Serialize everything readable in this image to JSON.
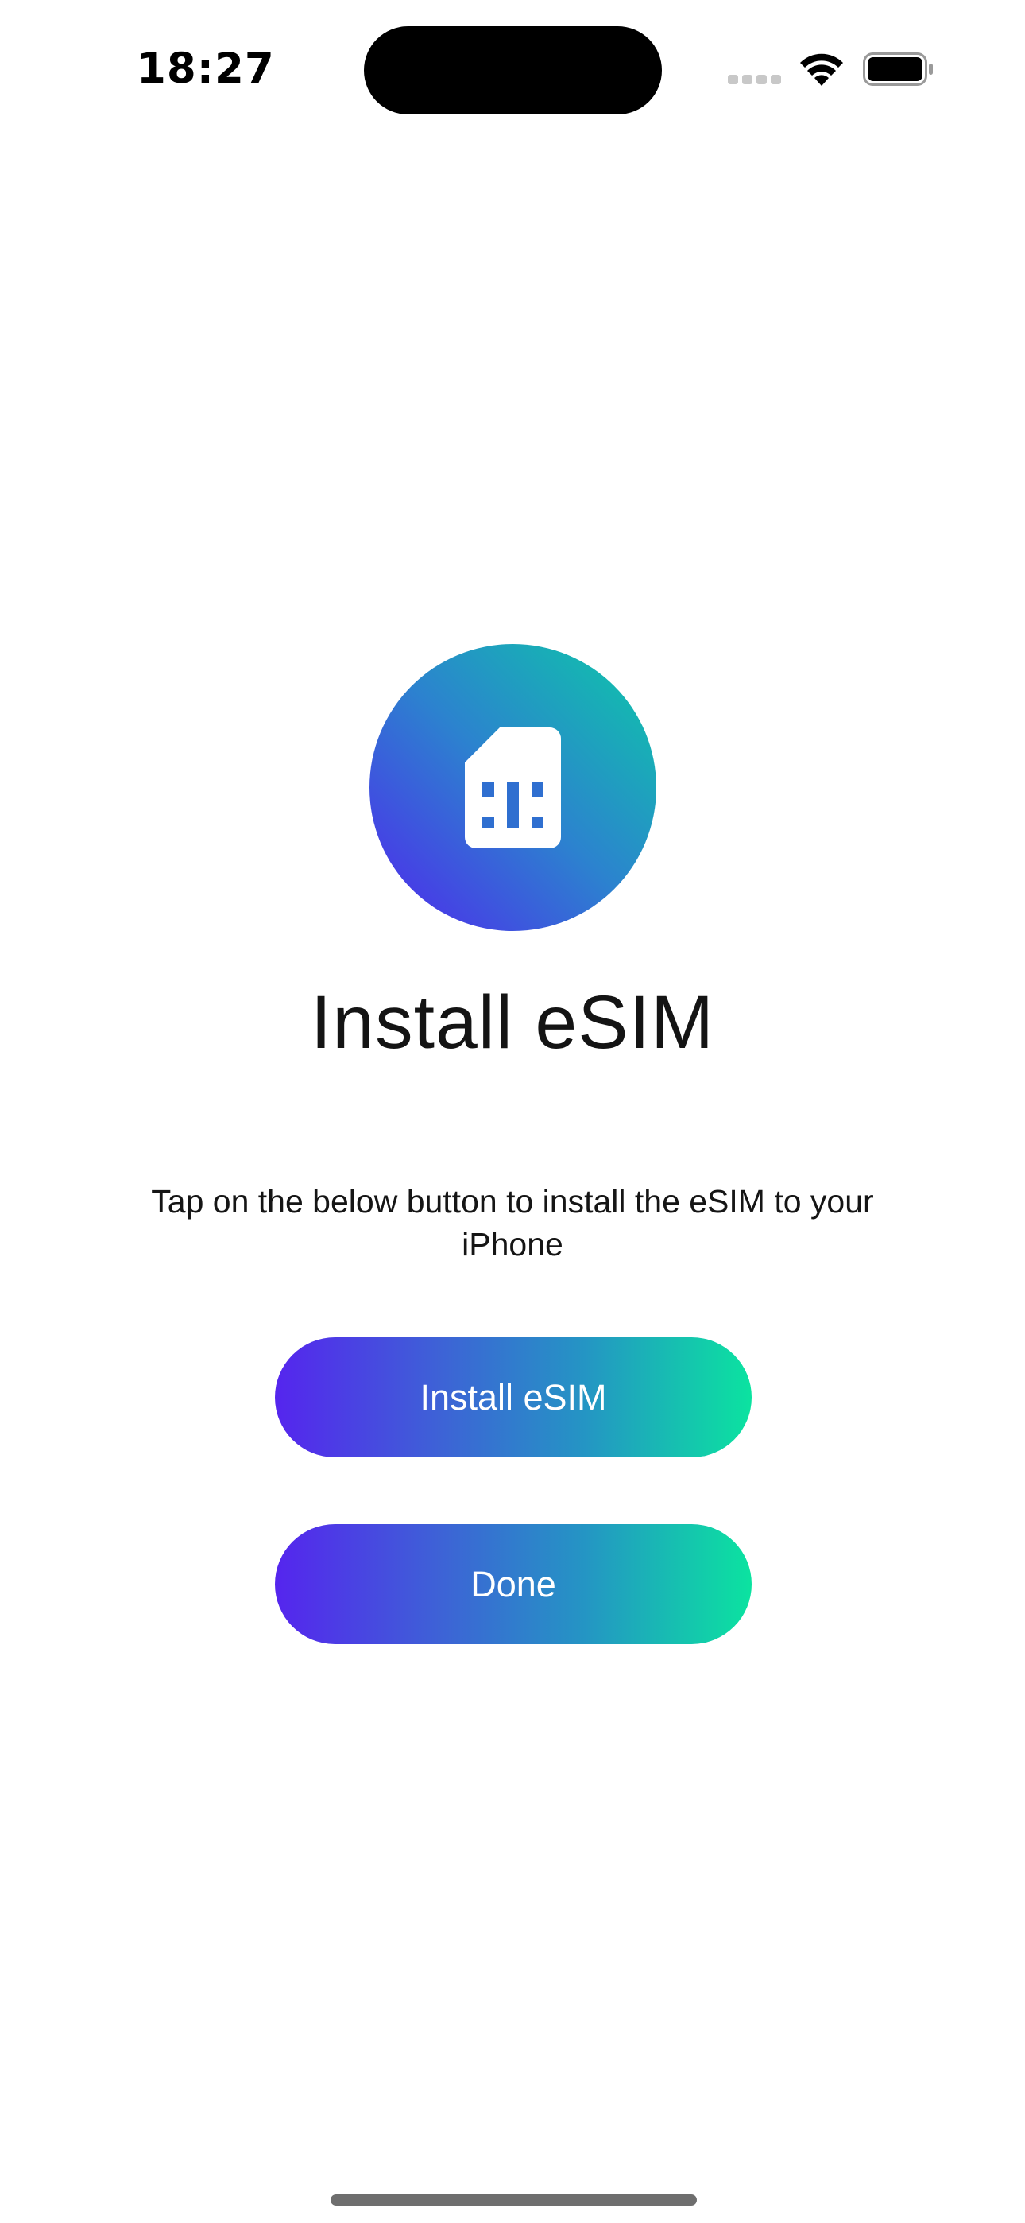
{
  "status_bar": {
    "time": "18:27",
    "icons": [
      "cellular-signal-icon",
      "wifi-icon",
      "battery-icon"
    ]
  },
  "hero": {
    "icon": "sim-card-icon",
    "gradient": [
      "#5025EE",
      "#0CCAA7"
    ]
  },
  "title": "Install eSIM",
  "description": "Tap on the below button to install the eSIM to your iPhone",
  "buttons": {
    "install_label": "Install eSIM",
    "done_label": "Done"
  },
  "colors": {
    "accent_start": "#5525EE",
    "accent_end": "#0BE3A0",
    "text": "#151515",
    "background": "#FFFFFF"
  }
}
